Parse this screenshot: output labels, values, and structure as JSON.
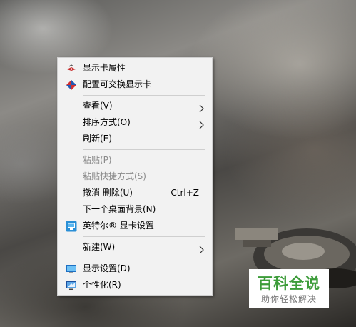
{
  "context_menu": {
    "items": [
      {
        "label": "显示卡属性",
        "icon": "graphics-properties-icon",
        "enabled": true
      },
      {
        "label": "配置可交换显示卡",
        "icon": "switchable-graphics-icon",
        "enabled": true
      },
      {
        "label": "查看(V)",
        "has_submenu": true,
        "enabled": true
      },
      {
        "label": "排序方式(O)",
        "has_submenu": true,
        "enabled": true
      },
      {
        "label": "刷新(E)",
        "enabled": true
      },
      {
        "label": "粘贴(P)",
        "enabled": false
      },
      {
        "label": "粘贴快捷方式(S)",
        "enabled": false
      },
      {
        "label": "撤消 删除(U)",
        "shortcut": "Ctrl+Z",
        "enabled": true
      },
      {
        "label": "下一个桌面背景(N)",
        "enabled": true
      },
      {
        "label": "英特尔® 显卡设置",
        "icon": "intel-graphics-icon",
        "enabled": true
      },
      {
        "label": "新建(W)",
        "has_submenu": true,
        "enabled": true
      },
      {
        "label": "显示设置(D)",
        "icon": "display-settings-icon",
        "enabled": true
      },
      {
        "label": "个性化(R)",
        "icon": "personalize-icon",
        "enabled": true
      }
    ]
  },
  "watermark": {
    "brand": "百科全说",
    "tagline": "助你轻松解决",
    "brand_color": "#3d9c3a"
  }
}
